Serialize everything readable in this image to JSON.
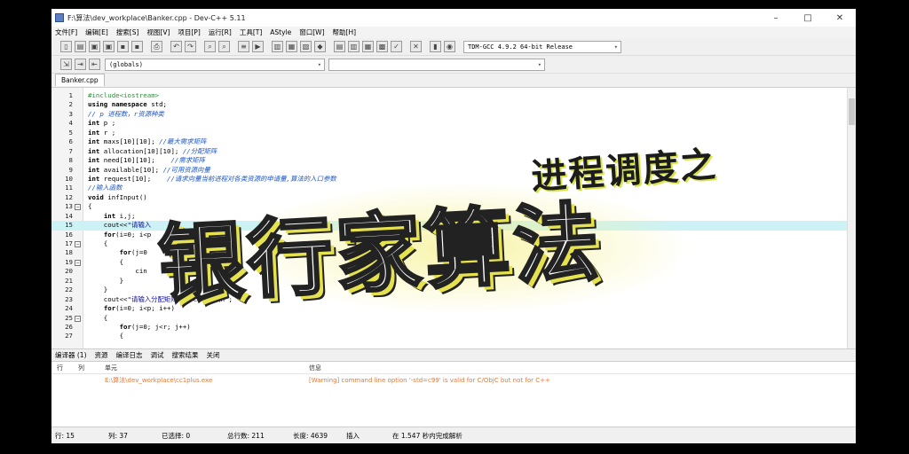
{
  "window": {
    "title": "F:\\算法\\dev_workplace\\Banker.cpp - Dev-C++ 5.11",
    "min_label": "–",
    "max_label": "□",
    "close_label": "✕"
  },
  "menu": [
    "文件[F]",
    "编辑[E]",
    "搜索[S]",
    "视图[V]",
    "项目[P]",
    "运行[R]",
    "工具[T]",
    "AStyle",
    "窗口[W]",
    "帮助[H]"
  ],
  "toolbar": {
    "compiler": "TDM-GCC 4.9.2 64-bit Release",
    "scope": "(globals)",
    "member": ""
  },
  "file_tab": "Banker.cpp",
  "code_lines": [
    {
      "n": "1",
      "html": "<span class='pp'>#include&lt;iostream&gt;</span>"
    },
    {
      "n": "2",
      "html": "<span class='kw'>using namespace</span> std;"
    },
    {
      "n": "3",
      "html": "<span class='cm'>// p 进程数，r资源种类</span>"
    },
    {
      "n": "4",
      "html": "<span class='kw'>int</span> p ;"
    },
    {
      "n": "5",
      "html": "<span class='kw'>int</span> r ;"
    },
    {
      "n": "6",
      "html": "<span class='kw'>int</span> maxs[10][10]; <span class='cm'>//最大需求矩阵</span>"
    },
    {
      "n": "7",
      "html": "<span class='kw'>int</span> allocation[10][10]; <span class='cm'>//分配矩阵</span>"
    },
    {
      "n": "8",
      "html": "<span class='kw'>int</span> need[10][10];    <span class='cm'>//需求矩阵</span>"
    },
    {
      "n": "9",
      "html": "<span class='kw'>int</span> available[10]; <span class='cm'>//可用资源向量</span>"
    },
    {
      "n": "10",
      "html": "<span class='kw'>int</span> request[10];    <span class='cm'>//请求向量当前进程对各类资源的申请量,算法的入口参数</span>"
    },
    {
      "n": "11",
      "html": "<span class='cm'>//输入函数</span>"
    },
    {
      "n": "12",
      "html": "<span class='kw'>void</span> infInput()"
    },
    {
      "n": "13",
      "html": "{",
      "fold": "−"
    },
    {
      "n": "14",
      "html": "    <span class='kw'>int</span> i,j;"
    },
    {
      "n": "15",
      "html": "    cout&lt;&lt;<span class='st'>\"请输入</span>",
      "hl": true
    },
    {
      "n": "16",
      "html": "    <span class='kw'>for</span>(i=0; i&lt;p"
    },
    {
      "n": "17",
      "html": "    {",
      "fold": "−"
    },
    {
      "n": "18",
      "html": "        <span class='kw'>for</span>(j=0"
    },
    {
      "n": "19",
      "html": "        {",
      "fold": "−"
    },
    {
      "n": "20",
      "html": "            cin"
    },
    {
      "n": "21",
      "html": "        }"
    },
    {
      "n": "22",
      "html": "    }"
    },
    {
      "n": "23",
      "html": "    cout&lt;&lt;<span class='st'>\"请输入分配矩阵allocation\\n\"</span>;"
    },
    {
      "n": "24",
      "html": "    <span class='kw'>for</span>(i=0; i&lt;p; i++)"
    },
    {
      "n": "25",
      "html": "    {",
      "fold": "−"
    },
    {
      "n": "26",
      "html": "        <span class='kw'>for</span>(j=0; j&lt;r; j++)"
    },
    {
      "n": "27",
      "html": "        {"
    }
  ],
  "lower_tabs": [
    "编译器 (1)",
    "资源",
    "编译日志",
    "调试",
    "搜索结果",
    "关闭"
  ],
  "messages": {
    "headers": [
      "行",
      "列",
      "单元",
      "信息"
    ],
    "rows": [
      {
        "line": "",
        "col": "",
        "unit": "E:\\算法\\dev_workplace\\cc1plus.exe",
        "info": "[Warning] command line option '-std=c99' is valid for C/ObjC but not for C++"
      }
    ]
  },
  "status": {
    "row": "行:  15",
    "col": "列:  37",
    "selected": "已选择:  0",
    "total_lines": "总行数:  211",
    "length": "长度:  4639",
    "mode": "插入",
    "parse": "在 1.547 秒内完成解析"
  },
  "overlay": {
    "subtitle": "进程调度之",
    "main": "银行家算法"
  }
}
